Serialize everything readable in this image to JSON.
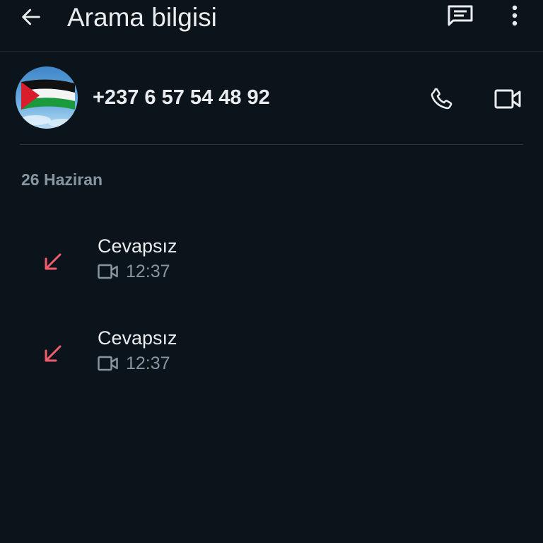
{
  "app_bar": {
    "title": "Arama bilgisi",
    "icons": {
      "back": "arrow-left-icon",
      "message": "message-icon",
      "more": "more-vertical-icon"
    }
  },
  "contact": {
    "phone_number": "+237 6 57 54 48 92",
    "avatar": "palestine-flag-avatar",
    "actions": {
      "voice_call": "phone-icon",
      "video_call": "video-camera-icon"
    }
  },
  "call_log": {
    "date_header": "26 Haziran",
    "entries": [
      {
        "status": "Cevapsız",
        "time": "12:37",
        "direction": "incoming-missed",
        "type": "video"
      },
      {
        "status": "Cevapsız",
        "time": "12:37",
        "direction": "incoming-missed",
        "type": "video"
      }
    ]
  },
  "colors": {
    "background": "#0b141b",
    "text_primary": "#e9edef",
    "text_secondary": "#8696a0",
    "missed_red": "#f15c6d",
    "divider": "#26333b"
  }
}
